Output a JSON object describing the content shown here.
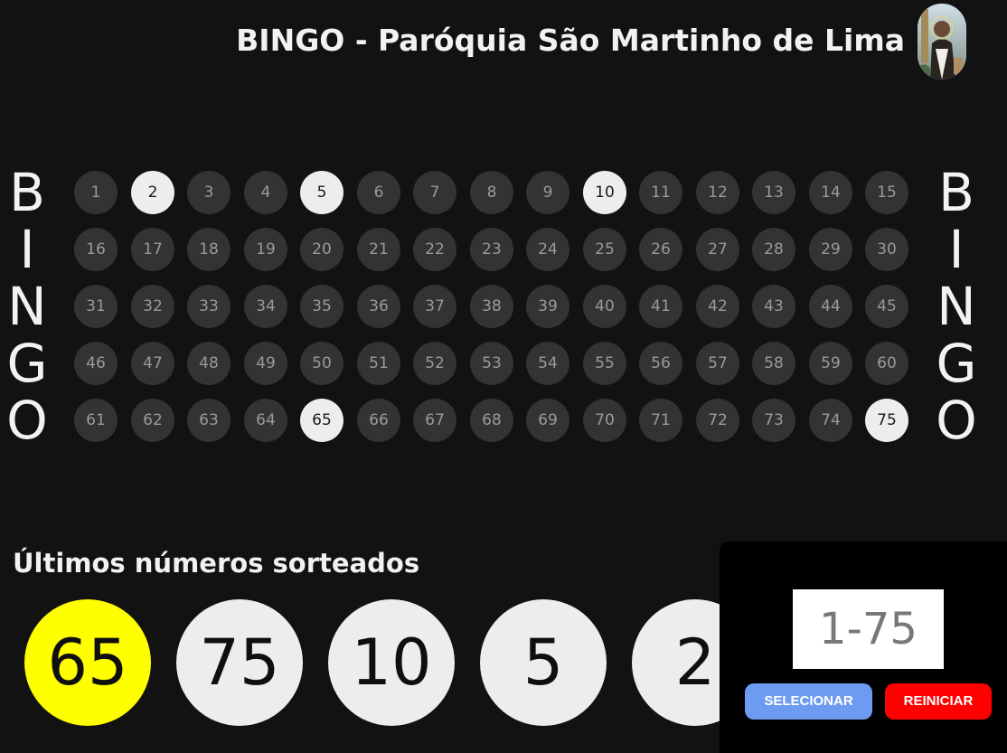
{
  "header": {
    "title": "BINGO - Paróquia São Martinho de Lima",
    "logo_icon": "saint-portrait-icon"
  },
  "side_letters": [
    "B",
    "I",
    "N",
    "G",
    "O"
  ],
  "board": {
    "rows": [
      [
        1,
        2,
        3,
        4,
        5,
        6,
        7,
        8,
        9,
        10,
        11,
        12,
        13,
        14,
        15
      ],
      [
        16,
        17,
        18,
        19,
        20,
        21,
        22,
        23,
        24,
        25,
        26,
        27,
        28,
        29,
        30
      ],
      [
        31,
        32,
        33,
        34,
        35,
        36,
        37,
        38,
        39,
        40,
        41,
        42,
        43,
        44,
        45
      ],
      [
        46,
        47,
        48,
        49,
        50,
        51,
        52,
        53,
        54,
        55,
        56,
        57,
        58,
        59,
        60
      ],
      [
        61,
        62,
        63,
        64,
        65,
        66,
        67,
        68,
        69,
        70,
        71,
        72,
        73,
        74,
        75
      ]
    ],
    "drawn": [
      2,
      5,
      10,
      65,
      75
    ]
  },
  "recent": {
    "title": "Últimos números sorteados",
    "numbers": [
      "65",
      "75",
      "10",
      "5",
      "2"
    ]
  },
  "controls": {
    "input_placeholder": "1-75",
    "select_label": "SELECIONAR",
    "reset_label": "REINICIAR"
  },
  "colors": {
    "background": "#121212",
    "ball_idle": "#333333",
    "ball_drawn": "#ededed",
    "latest_highlight": "#ffff00",
    "select_button": "#6d9bf1",
    "reset_button": "#ff0000"
  }
}
